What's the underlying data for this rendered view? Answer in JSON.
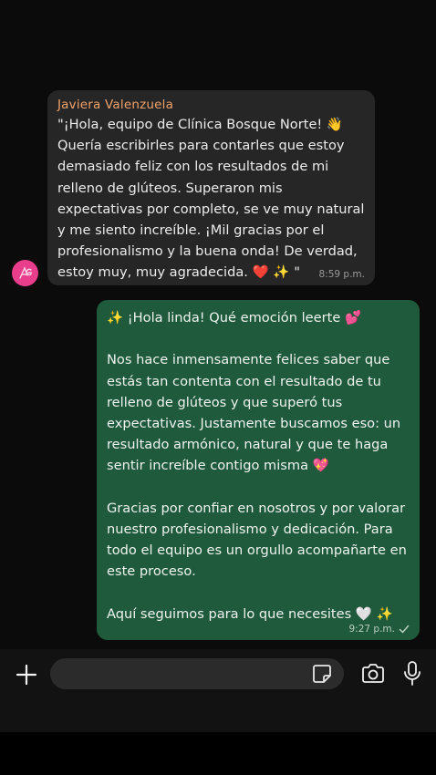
{
  "incoming": {
    "sender": "Javiera Valenzuela",
    "text": "\"¡Hola, equipo de Clínica Bosque Norte! 👋\nQuería escribirles para contarles que estoy\ndemasiado feliz con los resultados de mi\nrelleno de glúteos. Superaron mis\nexpectativas por completo, se ve muy natural\ny me siento increíble. ¡Mil gracias por el\nprofesionalismo y la buena onda! De verdad,\nestoy muy, muy agradecida. ❤️ ✨ \"",
    "time": "8:59 p.m."
  },
  "outgoing": {
    "text": "✨ ¡Hola linda! Qué emoción leerte 💕\n\nNos hace inmensamente felices saber que\nestás tan contenta con el resultado de tu\nrelleno de glúteos y que superó tus\nexpectativas. Justamente buscamos eso: un\nresultado armónico, natural y que te haga\nsentir increíble contigo misma 💖\n\nGracias por confiar en nosotros y por valorar\nnuestro profesionalismo y dedicación. Para\ntodo el equipo es un orgullo acompañarte en\neste proceso.\n\nAquí seguimos para lo que necesites 🤍 ✨",
    "time": "9:27 p.m.",
    "status_icon": "check-icon"
  },
  "composer": {
    "placeholder": "",
    "icons": [
      "plus-icon",
      "sticker-icon",
      "camera-icon",
      "mic-icon"
    ]
  },
  "colors": {
    "background": "#0b0b0b",
    "incoming_bubble": "#262626",
    "outgoing_bubble": "#1f5a3c",
    "sender_name": "#f2a36b",
    "avatar": "#e83e8c"
  }
}
